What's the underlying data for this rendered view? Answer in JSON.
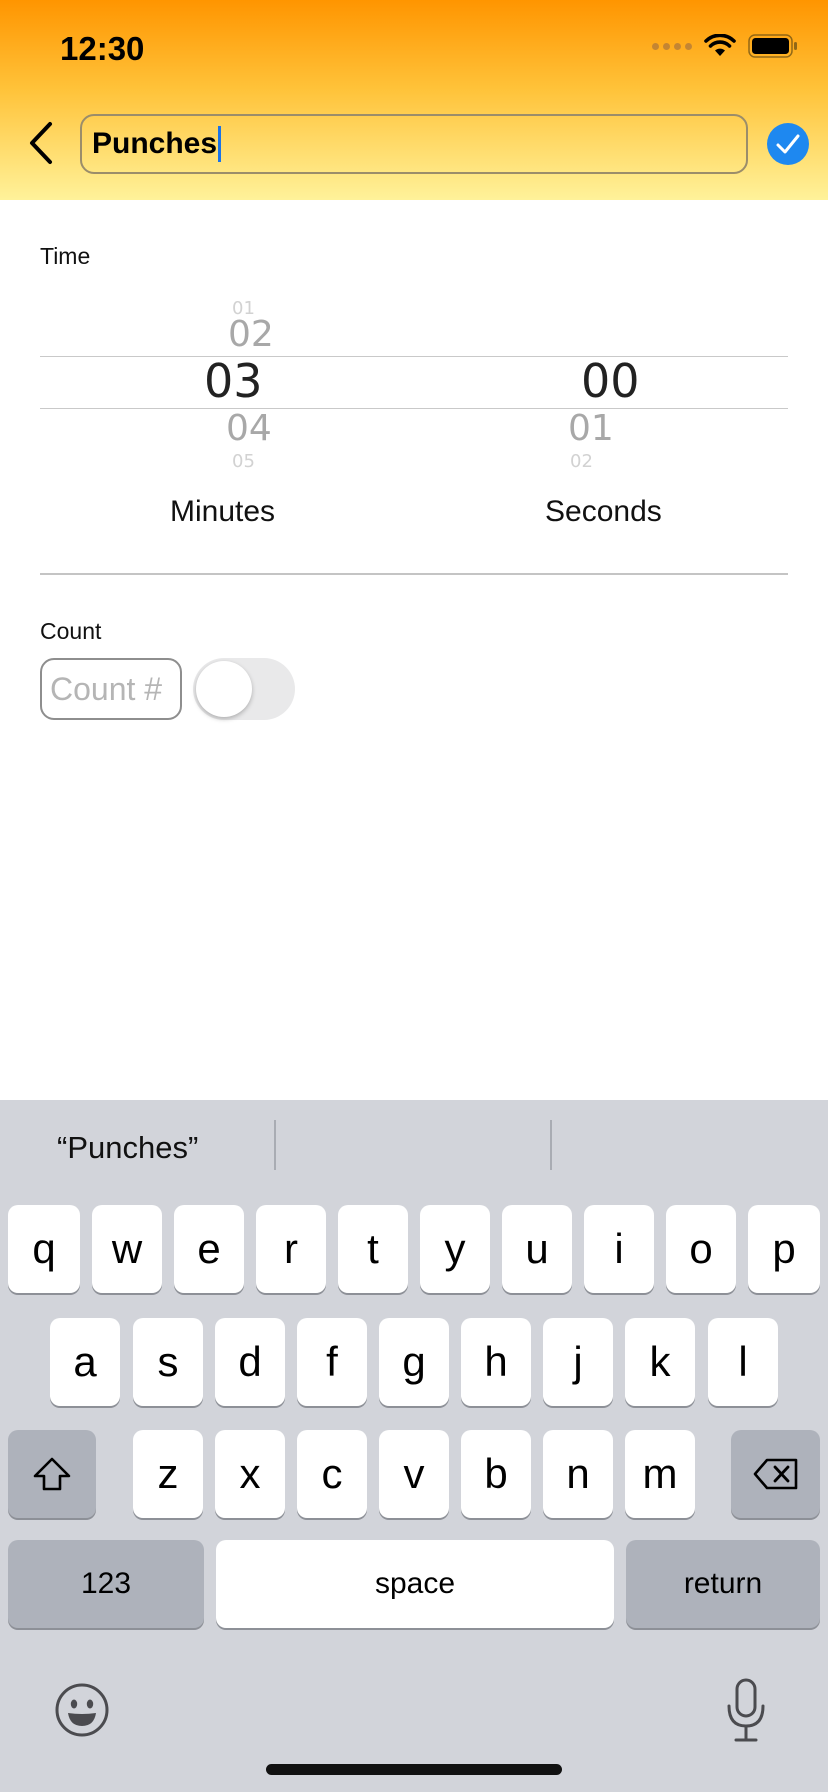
{
  "status_bar": {
    "time": "12:30"
  },
  "header": {
    "title_value": "Punches"
  },
  "time_section": {
    "label": "Time",
    "minutes": {
      "prev_faint": "01",
      "prev": "02",
      "selected": "03",
      "next": "04",
      "next_faint": "05",
      "label": "Minutes"
    },
    "seconds": {
      "selected": "00",
      "next": "01",
      "next_faint": "02",
      "label": "Seconds"
    }
  },
  "count_section": {
    "label": "Count",
    "placeholder": "Count #",
    "toggle_on": false
  },
  "keyboard": {
    "suggestion": "“Punches”",
    "row1": [
      "q",
      "w",
      "e",
      "r",
      "t",
      "y",
      "u",
      "i",
      "o",
      "p"
    ],
    "row2": [
      "a",
      "s",
      "d",
      "f",
      "g",
      "h",
      "j",
      "k",
      "l"
    ],
    "row3": [
      "z",
      "x",
      "c",
      "v",
      "b",
      "n",
      "m"
    ],
    "numbers_label": "123",
    "space_label": "space",
    "return_label": "return"
  },
  "colors": {
    "accent": "#1e88f0",
    "header_top": "#ff9500",
    "header_bottom": "#fff29a"
  },
  "icons": [
    "back-chevron-icon",
    "checkmark-icon",
    "wifi-icon",
    "battery-icon",
    "shift-icon",
    "delete-icon",
    "emoji-icon",
    "microphone-icon"
  ]
}
